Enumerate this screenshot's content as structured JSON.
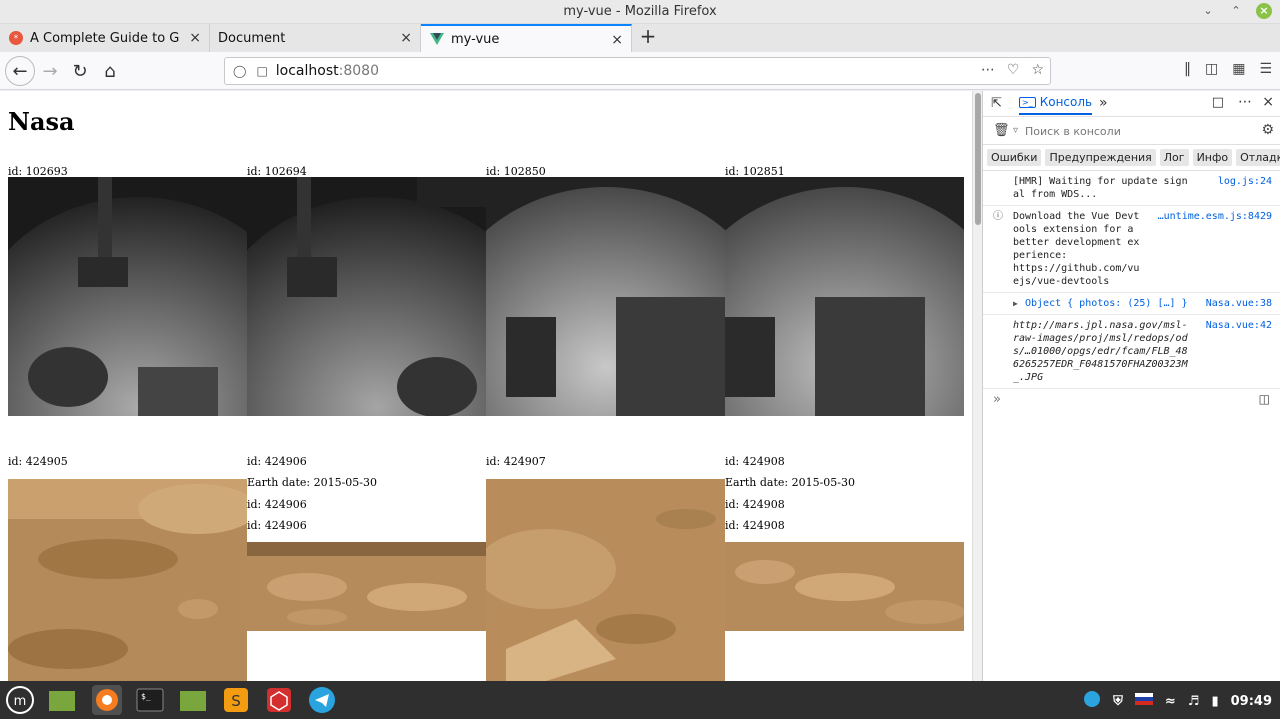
{
  "window": {
    "title": "my-vue - Mozilla Firefox"
  },
  "tabs": [
    {
      "label": "A Complete Guide to Grid |"
    },
    {
      "label": "Document"
    },
    {
      "label": "my-vue"
    }
  ],
  "url": {
    "host": "localhost",
    "port": ":8080"
  },
  "page": {
    "heading": "Nasa",
    "row1": [
      {
        "id": "id: 102693"
      },
      {
        "id": "id: 102694"
      },
      {
        "id": "id: 102850"
      },
      {
        "id": "id: 102851"
      }
    ],
    "row2": [
      {
        "id": "id: 424905"
      },
      {
        "id": "id: 424906",
        "earth": "Earth date: 2015-05-30",
        "id2": "id: 424906",
        "id3": "id: 424906"
      },
      {
        "id": "id: 424907"
      },
      {
        "id": "id: 424908",
        "earth": "Earth date: 2015-05-30",
        "id2": "id: 424908",
        "id3": "id: 424908"
      }
    ]
  },
  "devtools": {
    "tab": "Консоль",
    "filter_placeholder": "Поиск в консоли",
    "levels": [
      "Ошибки",
      "Предупреждения",
      "Лог",
      "Инфо",
      "Отладка"
    ],
    "messages": [
      {
        "text": "[HMR] Waiting for update signal from WDS...",
        "src": "log.js:24"
      },
      {
        "text": "Download the Vue Devtools extension for a better development experience:\nhttps://github.com/vuejs/vue-devtools",
        "src": "…untime.esm.js:8429"
      },
      {
        "text": "Object { photos: (25) […] }",
        "src": "Nasa.vue:38"
      },
      {
        "text": "http://mars.jpl.nasa.gov/msl-raw-images/proj/msl/redops/ods/…01000/opgs/edr/fcam/FLB_486265257EDR_F0481570FHAZ00323M_.JPG",
        "src": "Nasa.vue:42"
      }
    ]
  },
  "taskbar": {
    "clock": "09:49"
  }
}
